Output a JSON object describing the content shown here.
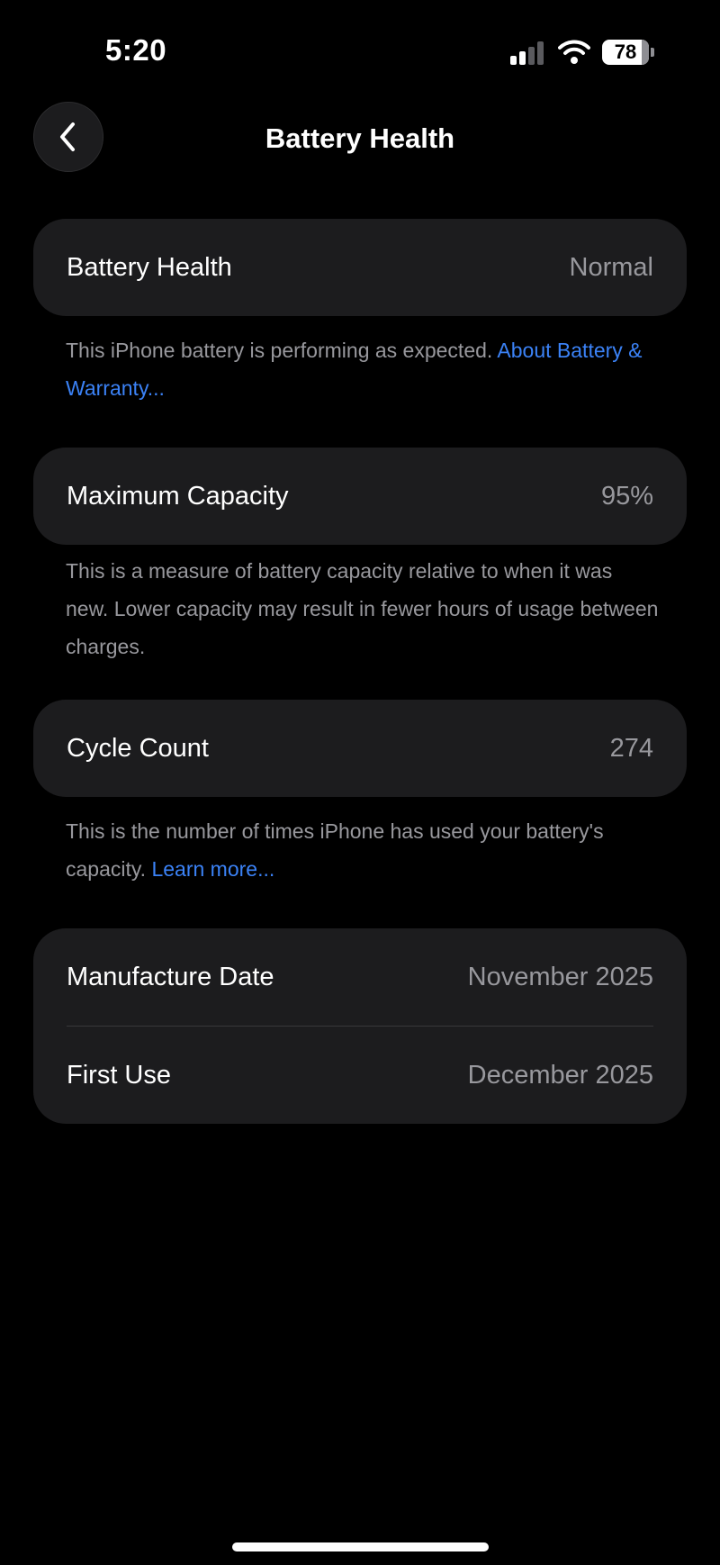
{
  "status_bar": {
    "time": "5:20",
    "battery_level": "78",
    "icons": [
      "cellular-signal-icon",
      "wifi-icon",
      "battery-icon"
    ]
  },
  "nav": {
    "title": "Battery Health",
    "back_icon": "chevron-left-icon"
  },
  "battery_health": {
    "label": "Battery Health",
    "value": "Normal",
    "footnote": "This iPhone battery is performing as expected. ",
    "link": "About Battery & Warranty..."
  },
  "max_capacity": {
    "label": "Maximum Capacity",
    "value": "95%",
    "footnote": "This is a measure of battery capacity relative to when it was new. Lower capacity may result in fewer hours of usage between charges."
  },
  "cycle_count": {
    "label": "Cycle Count",
    "value": "274",
    "footnote": "This is the number of times iPhone has used your battery's capacity. ",
    "link": "Learn more..."
  },
  "dates": {
    "manufacture_label": "Manufacture Date",
    "manufacture_value": "November 2025",
    "first_use_label": "First Use",
    "first_use_value": "December 2025"
  },
  "colors": {
    "background": "#000000",
    "card": "#1c1c1e",
    "secondary_text": "#98989d",
    "link": "#3b82f6"
  }
}
